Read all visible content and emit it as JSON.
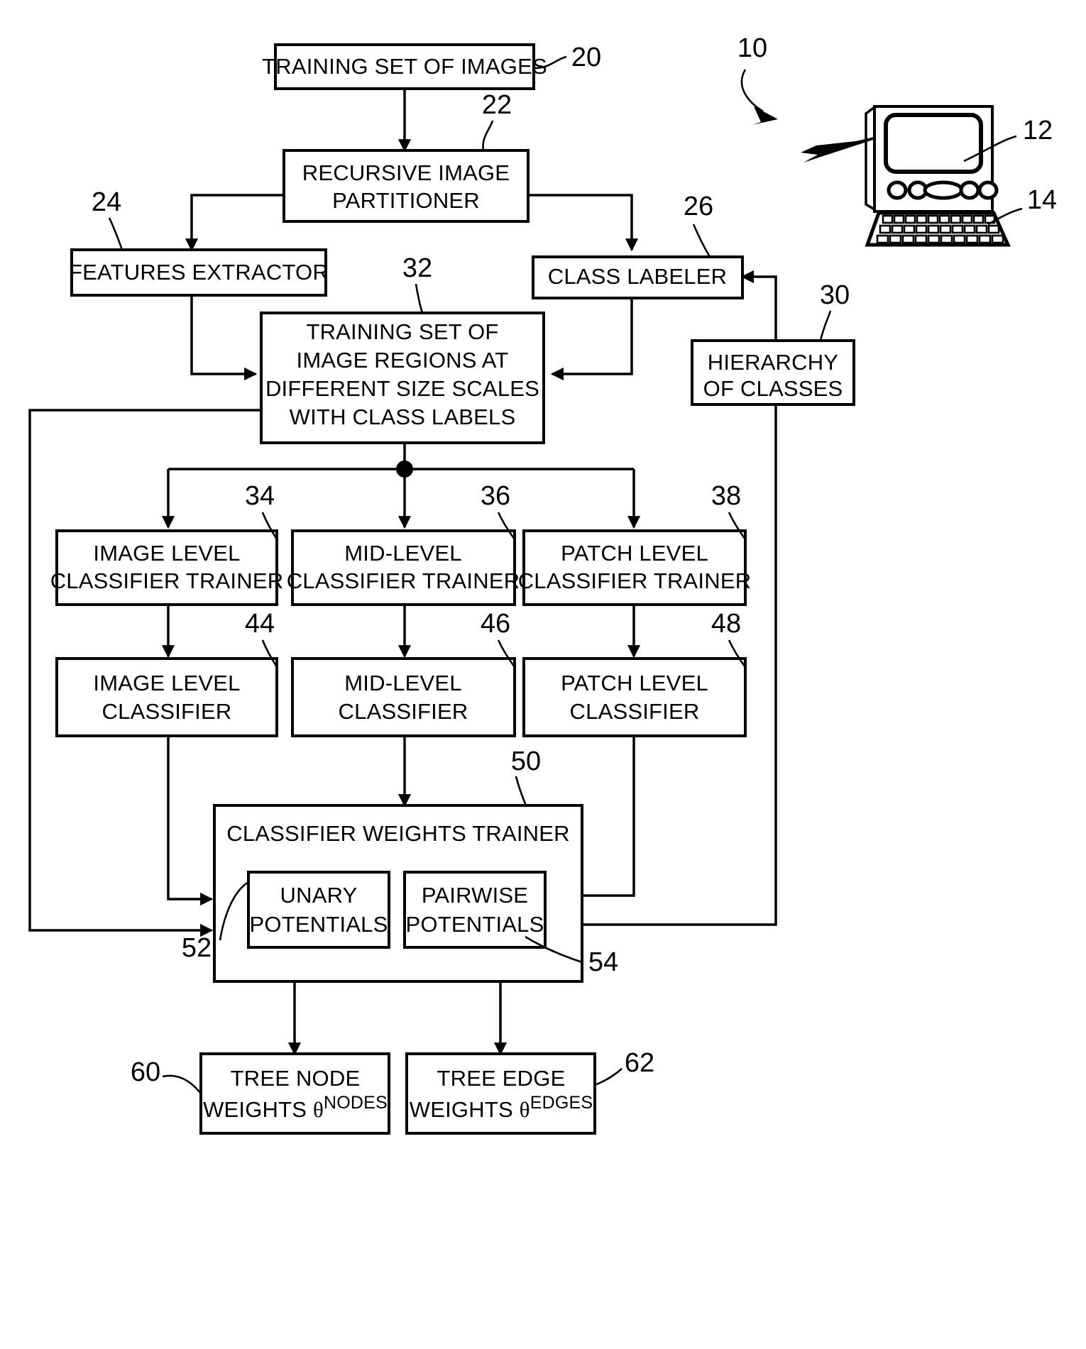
{
  "figure": {
    "type": "patent-flow-diagram",
    "system_ref": "10",
    "background": "#ffffff",
    "line_color": "#000000"
  },
  "boxes": {
    "training_set_images": {
      "label": "TRAINING SET OF IMAGES",
      "ref": "20"
    },
    "recursive_partitioner": {
      "line1": "RECURSIVE IMAGE",
      "line2": "PARTITIONER",
      "ref": "22"
    },
    "features_extractor": {
      "label": "FEATURES EXTRACTOR",
      "ref": "24"
    },
    "class_labeler": {
      "label": "CLASS LABELER",
      "ref": "26"
    },
    "hierarchy_of_classes": {
      "line1": "HIERARCHY",
      "line2": "OF CLASSES",
      "ref": "30"
    },
    "training_set_regions": {
      "line1": "TRAINING SET OF",
      "line2": "IMAGE REGIONS AT",
      "line3": "DIFFERENT SIZE SCALES",
      "line4": "WITH CLASS LABELS",
      "ref": "32"
    },
    "image_level_trainer": {
      "line1": "IMAGE LEVEL",
      "line2": "CLASSIFIER TRAINER",
      "ref": "34"
    },
    "mid_level_trainer": {
      "line1": "MID-LEVEL",
      "line2": "CLASSIFIER TRAINER",
      "ref": "36"
    },
    "patch_level_trainer": {
      "line1": "PATCH LEVEL",
      "line2": "CLASSIFIER TRAINER",
      "ref": "38"
    },
    "image_level_classifier": {
      "line1": "IMAGE LEVEL",
      "line2": "CLASSIFIER",
      "ref": "44"
    },
    "mid_level_classifier": {
      "line1": "MID-LEVEL",
      "line2": "CLASSIFIER",
      "ref": "46"
    },
    "patch_level_classifier": {
      "line1": "PATCH LEVEL",
      "line2": "CLASSIFIER",
      "ref": "48"
    },
    "classifier_weights_trainer": {
      "label": "CLASSIFIER WEIGHTS TRAINER",
      "ref": "50"
    },
    "unary_potentials": {
      "line1": "UNARY",
      "line2": "POTENTIALS",
      "ref": "52"
    },
    "pairwise_potentials": {
      "line1": "PAIRWISE",
      "line2": "POTENTIALS",
      "ref": "54"
    },
    "tree_node_weights": {
      "line1": "TREE NODE",
      "line2_prefix": "WEIGHTS ",
      "theta": "θ",
      "superscript": "NODES",
      "ref": "60"
    },
    "tree_edge_weights": {
      "line1": "TREE EDGE",
      "line2_prefix": "WEIGHTS ",
      "theta": "θ",
      "superscript": "EDGES",
      "ref": "62"
    }
  },
  "computer": {
    "name": "laptop-computer-illustration",
    "display_ref": "12",
    "keyboard_ref": "14",
    "system_ref": "10"
  }
}
